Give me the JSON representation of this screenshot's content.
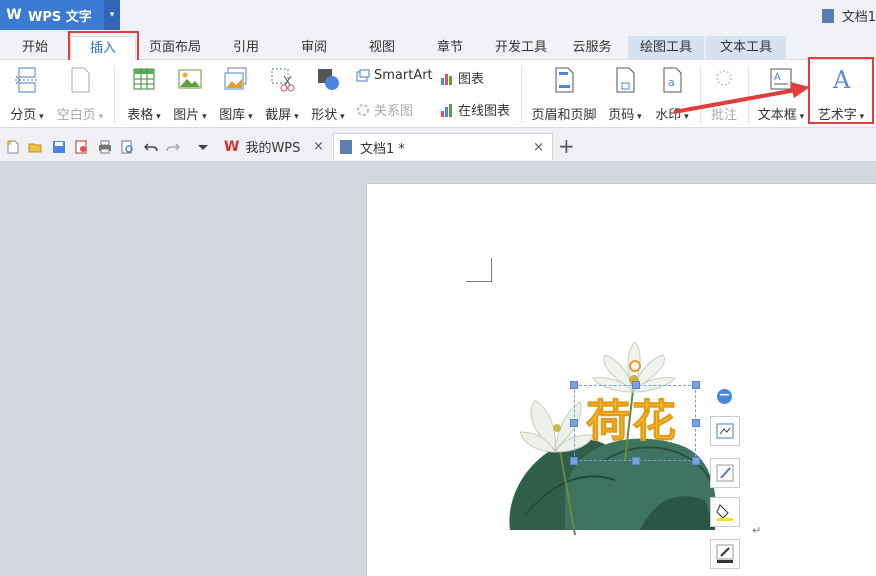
{
  "app": {
    "logo": "W",
    "name": "WPS 文字",
    "dropdown": "▾"
  },
  "window": {
    "doc_title": "文档1"
  },
  "tabs": [
    {
      "label": "开始"
    },
    {
      "label": "插入"
    },
    {
      "label": "页面布局"
    },
    {
      "label": "引用"
    },
    {
      "label": "审阅"
    },
    {
      "label": "视图"
    },
    {
      "label": "章节"
    },
    {
      "label": "开发工具"
    },
    {
      "label": "云服务"
    },
    {
      "label": "绘图工具"
    },
    {
      "label": "文本工具"
    }
  ],
  "ribbon": {
    "page_break": "分页",
    "blank_page": "空白页",
    "table": "表格",
    "picture": "图片",
    "gallery": "图库",
    "screenshot": "截屏",
    "shape": "形状",
    "smartart": "SmartArt",
    "chart": "图表",
    "relation": "关系图",
    "online_chart": "在线图表",
    "header_footer": "页眉和页脚",
    "page_number": "页码",
    "watermark": "水印",
    "comment": "批注",
    "textbox": "文本框",
    "wordart": "艺术字"
  },
  "doc_tabs": [
    {
      "label": "我的WPS",
      "close": "×"
    },
    {
      "label": "文档1 *",
      "close": "×"
    }
  ],
  "doc_tab_add": "+",
  "document": {
    "wordart_text": "荷花",
    "para_mark": "↵"
  },
  "colors": {
    "accent": "#3c7bd2",
    "highlight": "#e23c3c",
    "wordart": "#f6c928"
  }
}
